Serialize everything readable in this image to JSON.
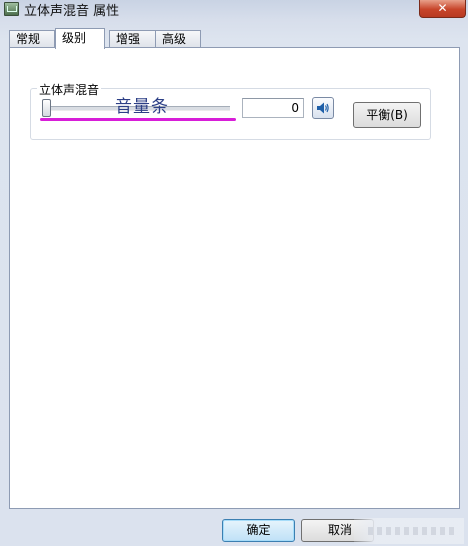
{
  "window": {
    "title": "立体声混音 属性",
    "close_label": "✕"
  },
  "tabs": [
    {
      "label": "常规",
      "active": false
    },
    {
      "label": "级别",
      "active": true
    },
    {
      "label": "增强",
      "active": false
    },
    {
      "label": "高级",
      "active": false
    }
  ],
  "levels": {
    "group_label": "立体声混音",
    "volume_value": "0",
    "volume_level_percent": 0,
    "annotation_text": "音量条",
    "annotation_color": "#d81ed8",
    "mute_icon": "speaker-icon",
    "balance_label": "平衡(B)"
  },
  "footer": {
    "ok_label": "确定",
    "cancel_label": "取消"
  }
}
